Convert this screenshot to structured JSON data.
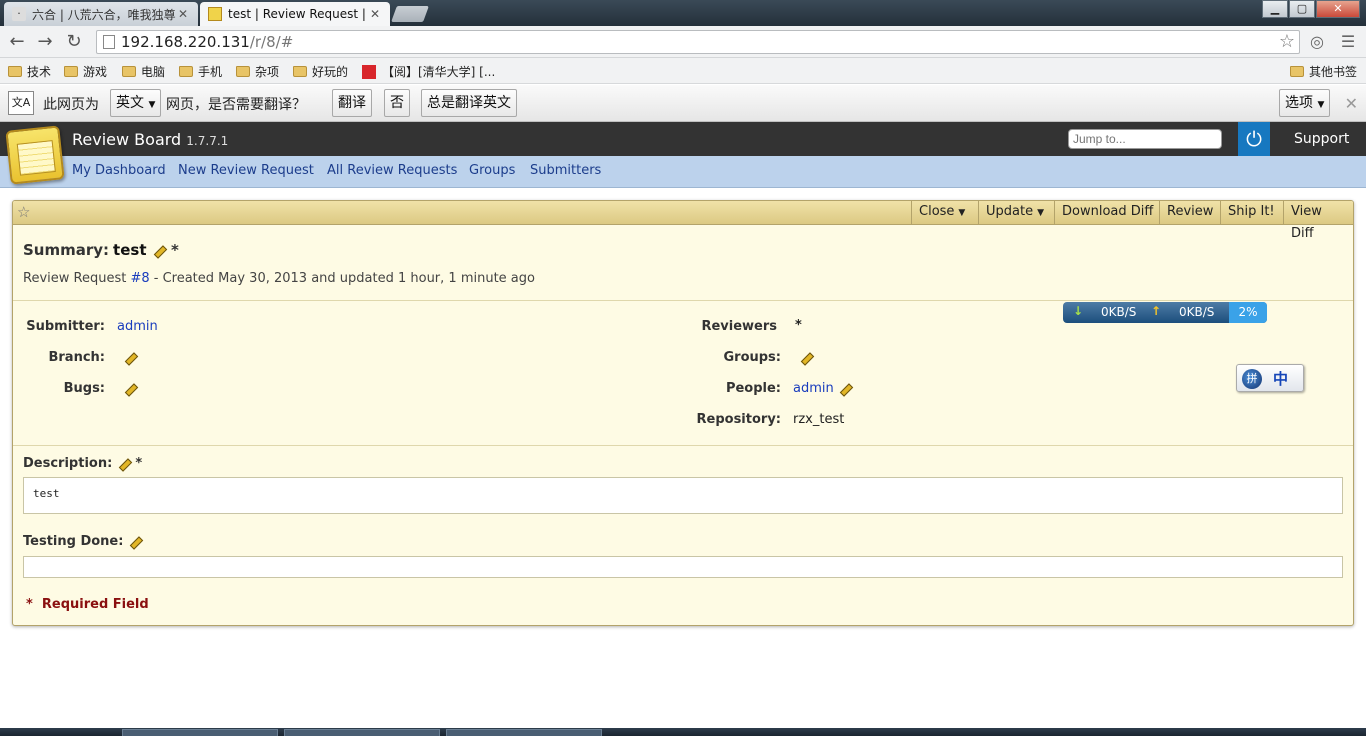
{
  "browser": {
    "tabs": [
      {
        "title": "六合 | 八荒六合，唯我独尊",
        "active": false
      },
      {
        "title": "test | Review Request | Review Board",
        "active": true
      }
    ],
    "window_controls": {
      "minimize": "▁",
      "maximize": "▢",
      "close": "✕"
    },
    "url_host": "192.168.220.131",
    "url_path": "/r/8/#",
    "bookmarks": [
      "技术",
      "游戏",
      "电脑",
      "手机",
      "杂项",
      "好玩的",
      "【阅】[清华大学] [..."
    ],
    "bookmarks_other": "其他书签"
  },
  "translate_bar": {
    "icon_text": "文A",
    "prefix": "此网页为",
    "language": "英文",
    "question": "网页，是否需要翻译？",
    "translate_btn": "翻译",
    "no_btn": "否",
    "always_btn": "总是翻译英文",
    "options_btn": "选项",
    "close": "✕"
  },
  "header": {
    "title": "Review Board",
    "version": "1.7.7.1",
    "jump_placeholder": "Jump to...",
    "support": "Support"
  },
  "nav": [
    "My Dashboard",
    "New Review Request",
    "All Review Requests",
    "Groups",
    "Submitters"
  ],
  "actions": [
    {
      "label": "Close",
      "dropdown": true
    },
    {
      "label": "Update",
      "dropdown": true
    },
    {
      "label": "Download Diff",
      "dropdown": false
    },
    {
      "label": "Review",
      "dropdown": false
    },
    {
      "label": "Ship It!",
      "dropdown": false
    },
    {
      "label": "View Diff",
      "dropdown": false
    }
  ],
  "review_request": {
    "summary_label": "Summary:",
    "summary": "test",
    "meta_prefix": "Review Request ",
    "id_link": "#8",
    "meta_suffix": " - Created May 30, 2013 and updated 1 hour, 1 minute ago",
    "fields_left": [
      {
        "label": "Submitter:",
        "value": "admin",
        "link": true,
        "editable": false
      },
      {
        "label": "Branch:",
        "value": "",
        "link": false,
        "editable": true
      },
      {
        "label": "Bugs:",
        "value": "",
        "link": false,
        "editable": true
      }
    ],
    "reviewers_label": "Reviewers",
    "reviewers_required": "*",
    "fields_right": [
      {
        "label": "Groups:",
        "value": "",
        "link": false,
        "editable": true
      },
      {
        "label": "People:",
        "value": "admin",
        "link": true,
        "editable": true
      },
      {
        "label": "Repository:",
        "value": "rzx_test",
        "link": false,
        "editable": false
      }
    ],
    "description_label": "Description:",
    "description": "test",
    "testing_label": "Testing Done:",
    "testing_done": "",
    "required_mark": "*",
    "required_text": "Required Field"
  },
  "net_monitor": {
    "down": "0KB/S",
    "up": "0KB/S",
    "percent": "2%"
  },
  "ime": {
    "label": "中",
    "ball": "拼"
  },
  "colors": {
    "header_bg": "#333333",
    "nav_bg": "#bcd2ec",
    "box_bg": "#fefbe4",
    "link": "#1a3dbd",
    "required": "#8a1010"
  }
}
